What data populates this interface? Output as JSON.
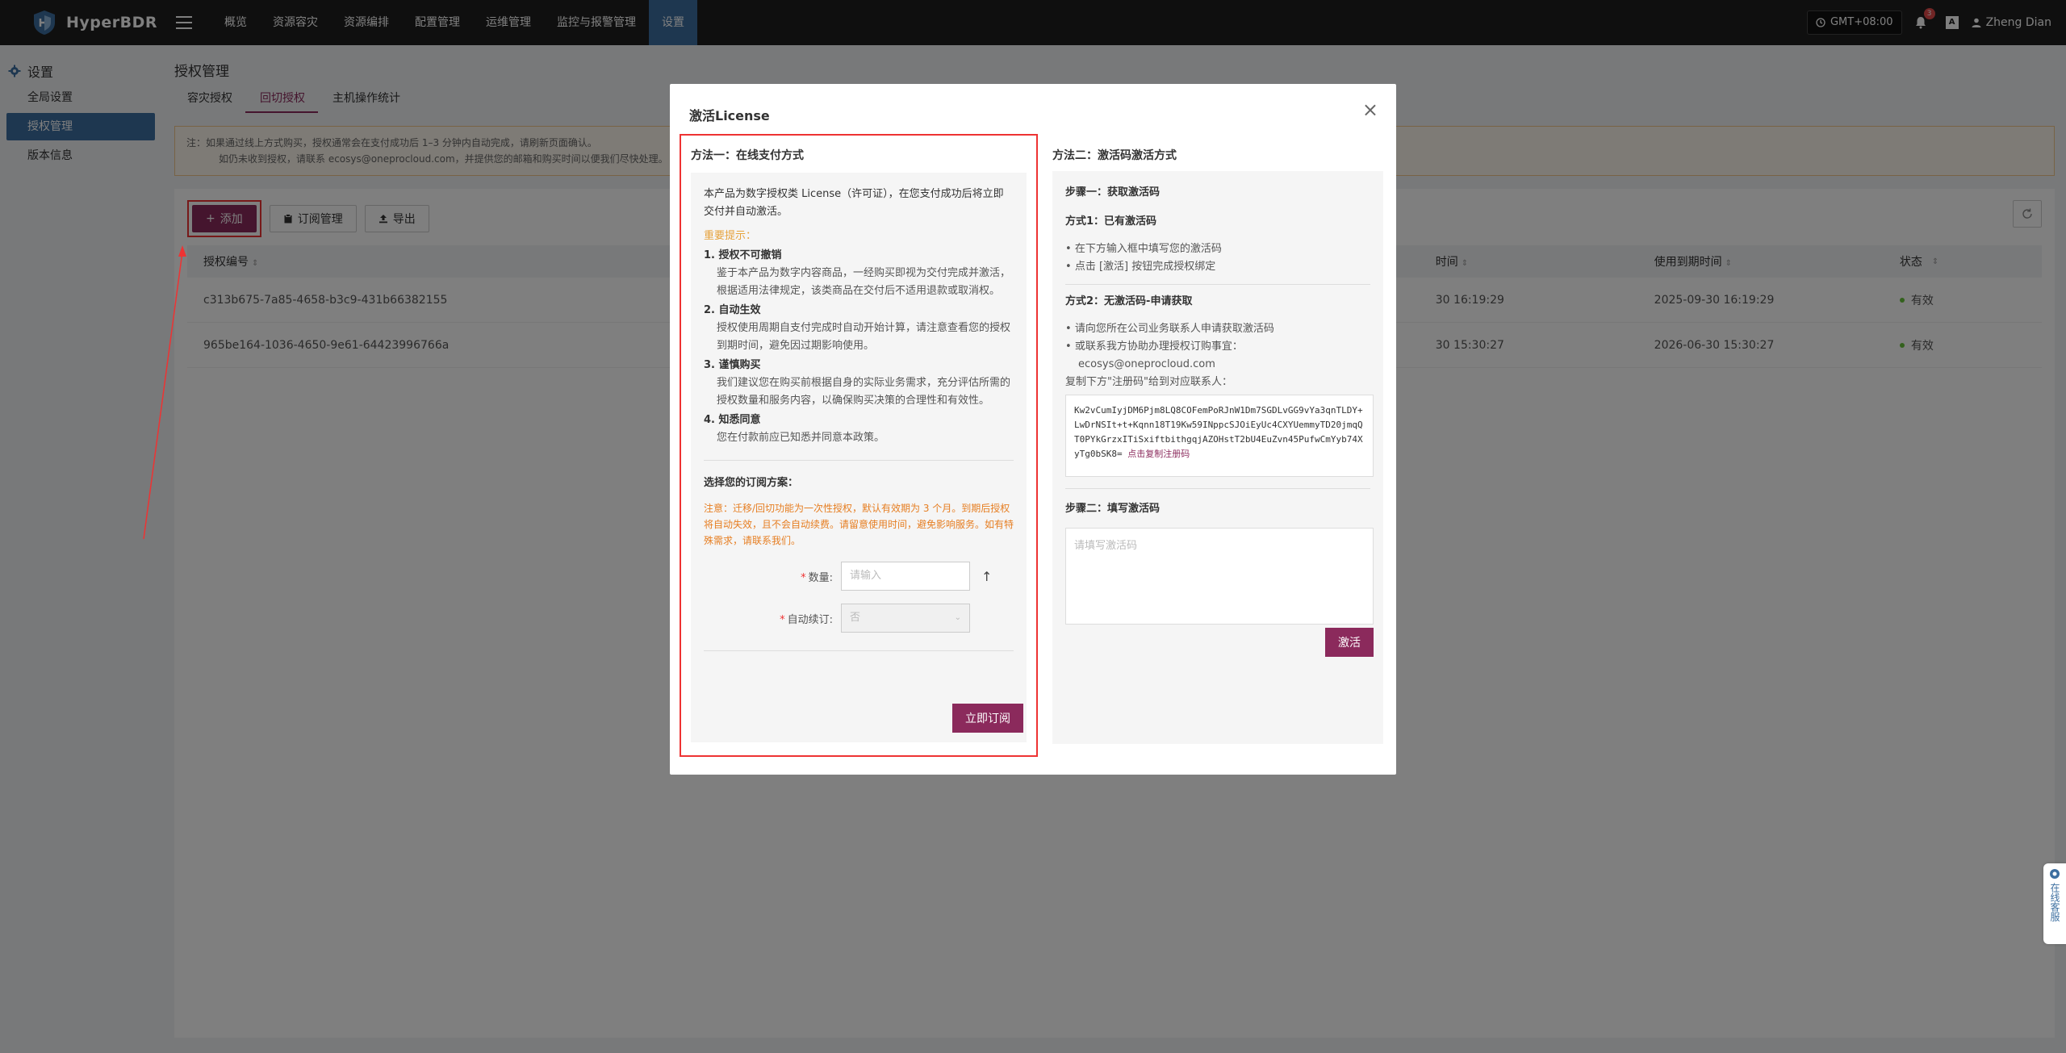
{
  "app": {
    "logo_text": "HyperBDR"
  },
  "nav": {
    "items": [
      {
        "label": "概览"
      },
      {
        "label": "资源容灾"
      },
      {
        "label": "资源编排"
      },
      {
        "label": "配置管理"
      },
      {
        "label": "运维管理"
      },
      {
        "label": "监控与报警管理"
      },
      {
        "label": "设置"
      }
    ],
    "active_index": 6,
    "timezone": "GMT+08:00",
    "notification_count": "3",
    "lang_label": "A",
    "user_name": "Zheng Dian"
  },
  "sidebar": {
    "title": "设置",
    "items": [
      {
        "label": "全局设置"
      },
      {
        "label": "授权管理"
      },
      {
        "label": "版本信息"
      }
    ]
  },
  "page": {
    "title": "授权管理",
    "tabs": [
      {
        "label": "容灾授权"
      },
      {
        "label": "回切授权"
      },
      {
        "label": "主机操作统计"
      }
    ],
    "notice_line1": "注：如果通过线上方式购买，授权通常会在支付成功后 1–3 分钟内自动完成，请刷新页面确认。",
    "notice_line2": "如仍未收到授权，请联系 ecosys@oneprocloud.com，并提供您的邮箱和购买时间以便我们尽快处理。",
    "toolbar": {
      "add_label": "添加",
      "subscription_label": "订阅管理",
      "export_label": "导出"
    },
    "table": {
      "columns": [
        "授权编号",
        "时间",
        "使用到期时间",
        "状态"
      ],
      "rows": [
        {
          "id": "c313b675-7a85-4658-b3c9-431b66382155",
          "start": "30 16:19:29",
          "end": "2025-09-30 16:19:29",
          "status": "有效"
        },
        {
          "id": "965be164-1036-4650-9e61-64423996766a",
          "start": "30 15:30:27",
          "end": "2026-06-30 15:30:27",
          "status": "有效"
        }
      ]
    }
  },
  "modal": {
    "title": "激活License",
    "method1": {
      "title": "方法一：在线支付方式",
      "intro": "本产品为数字授权类 License（许可证），在您支付成功后将立即交付并自动激活。",
      "important": "重要提示：",
      "sections": [
        {
          "h": "1. 授权不可撤销",
          "p": "鉴于本产品为数字内容商品，一经购买即视为交付完成并激活，根据适用法律规定，该类商品在交付后不适用退款或取消权。"
        },
        {
          "h": "2. 自动生效",
          "p": "授权使用周期自支付完成时自动开始计算，请注意查看您的授权到期时间，避免因过期影响使用。"
        },
        {
          "h": "3. 谨慎购买",
          "p": "我们建议您在购买前根据自身的实际业务需求，充分评估所需的授权数量和服务内容，以确保购买决策的合理性和有效性。"
        },
        {
          "h": "4. 知悉同意",
          "p": "您在付款前应已知悉并同意本政策。"
        }
      ],
      "plan_title": "选择您的订阅方案：",
      "plan_note": "注意：迁移/回切功能为一次性授权，默认有效期为 3 个月。到期后授权将自动失效，且不会自动续费。请留意使用时间，避免影响服务。如有特殊需求，请联系我们。",
      "qty_label": "数量:",
      "qty_placeholder": "请输入",
      "renew_label": "自动续订:",
      "renew_value": "否",
      "submit_label": "立即订阅"
    },
    "method2": {
      "title": "方法二：激活码激活方式",
      "step1": "步骤一：获取激活码",
      "way1_title": "方式1：已有激活码",
      "way1_items": [
        "在下方输入框中填写您的激活码",
        "点击 [激活] 按钮完成授权绑定"
      ],
      "way2_title": "方式2：无激活码-申请获取",
      "way2_items": [
        "请向您所在公司业务联系人申请获取激活码",
        "或联系我方协助办理授权订购事宜："
      ],
      "email": "ecosys@oneprocloud.com",
      "copy_hint": "复制下方\"注册码\"给到对应联系人：",
      "reg_code": "Kw2vCumIyjDM6Pjm8LQ8COFemPoRJnW1Dm7SGDLvGG9vYa3qnTLDY+LwDrNSIt+t+Kqnn18T19Kw59INppcSJOiEyUc4CXYUemmyTD20jmqQT0PYkGrzxITiSxiftbithgqjAZOHstT2bU4EuZvn45PufwCmYyb74XyTg0bSK8=",
      "copy_link": "点击复制注册码",
      "step2": "步骤二：填写激活码",
      "code_placeholder": "请填写激活码",
      "activate_label": "激活"
    }
  },
  "chat": {
    "label": "在线客服"
  },
  "colors": {
    "brand": "#8b2a5c",
    "nav_active": "#3d6fa0",
    "highlight_border": "#ee3333",
    "status_ok": "#67c23a"
  }
}
